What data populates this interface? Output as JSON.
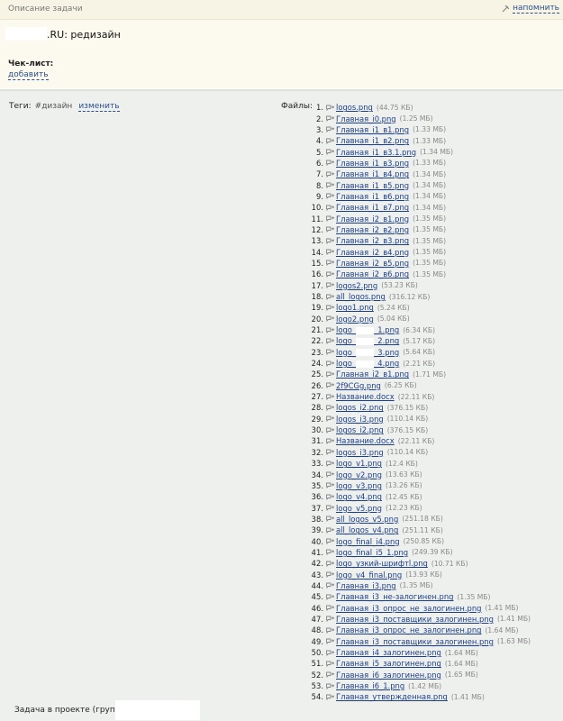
{
  "top_bar": {
    "title": "Описание задачи",
    "remind_label": "напомнить",
    "remind_icon": "pin-icon"
  },
  "header": {
    "project_suffix": ".RU:",
    "task_title": "редизайн"
  },
  "checklist": {
    "label": "Чек-лист:",
    "add_label": "добавить"
  },
  "tags": {
    "label": "Теги:",
    "items": [
      "#дизайн"
    ],
    "edit_label": "изменить"
  },
  "files_label": "Файлы:",
  "files": [
    {
      "n": "1.",
      "name": "logos.png",
      "size": "(44.75 КБ)"
    },
    {
      "n": "2.",
      "name": "Главная_i0.png",
      "size": "(1.25 МБ)"
    },
    {
      "n": "3.",
      "name": "Главная_i1_в1.png",
      "size": "(1.33 МБ)"
    },
    {
      "n": "4.",
      "name": "Главная_i1_в2.png",
      "size": "(1.33 МБ)"
    },
    {
      "n": "5.",
      "name": "Главная_i1_в3.1.png",
      "size": "(1.34 МБ)"
    },
    {
      "n": "6.",
      "name": "Главная_i1_в3.png",
      "size": "(1.33 МБ)"
    },
    {
      "n": "7.",
      "name": "Главная_i1_в4.png",
      "size": "(1.34 МБ)"
    },
    {
      "n": "8.",
      "name": "Главная_i1_в5.png",
      "size": "(1.34 МБ)"
    },
    {
      "n": "9.",
      "name": "Главная_i1_в6.png",
      "size": "(1.34 МБ)"
    },
    {
      "n": "10.",
      "name": "Главная_i1_в7.png",
      "size": "(1.34 МБ)"
    },
    {
      "n": "11.",
      "name": "Главная_i2_в1.png",
      "size": "(1.35 МБ)"
    },
    {
      "n": "12.",
      "name": "Главная_i2_в2.png",
      "size": "(1.35 МБ)"
    },
    {
      "n": "13.",
      "name": "Главная_i2_в3.png",
      "size": "(1.35 МБ)"
    },
    {
      "n": "14.",
      "name": "Главная_i2_в4.png",
      "size": "(1.35 МБ)"
    },
    {
      "n": "15.",
      "name": "Главная_i2_в5.png",
      "size": "(1.35 МБ)"
    },
    {
      "n": "16.",
      "name": "Главная_i2_в6.png",
      "size": "(1.35 МБ)"
    },
    {
      "n": "17.",
      "name": "logos2.png",
      "size": "(53.23 КБ)"
    },
    {
      "n": "18.",
      "name": "all_logos.png",
      "size": "(316.12 КБ)"
    },
    {
      "n": "19.",
      "name": "logo1.png",
      "size": "(5.24 КБ)"
    },
    {
      "n": "20.",
      "name": "logo2.png",
      "size": "(5.04 КБ)"
    },
    {
      "n": "21.",
      "name": "logo_",
      "name2": "_1.png",
      "size": "(6.34 КБ)"
    },
    {
      "n": "22.",
      "name": "logo_",
      "name2": "_2.png",
      "size": "(5.17 КБ)"
    },
    {
      "n": "23.",
      "name": "logo_",
      "name2": "_3.png",
      "size": "(5.64 КБ)"
    },
    {
      "n": "24.",
      "name": "logo_",
      "name2": "_4.png",
      "size": "(2.21 КБ)"
    },
    {
      "n": "25.",
      "name": "Главная_i2_в1.png",
      "size": "(1.71 МБ)"
    },
    {
      "n": "26.",
      "name": "2f9CGg.png",
      "size": "(6.25 КБ)"
    },
    {
      "n": "27.",
      "name": "Название.docx",
      "size": "(22.11 КБ)"
    },
    {
      "n": "28.",
      "name": "logos_i2.png",
      "size": "(376.15 КБ)"
    },
    {
      "n": "29.",
      "name": "logos_i3.png",
      "size": "(110.14 КБ)"
    },
    {
      "n": "30.",
      "name": "logos_i2.png",
      "size": "(376.15 КБ)"
    },
    {
      "n": "31.",
      "name": "Название.docx",
      "size": "(22.11 КБ)"
    },
    {
      "n": "32.",
      "name": "logos_i3.png",
      "size": "(110.14 КБ)"
    },
    {
      "n": "33.",
      "name": "logo_v1.png",
      "size": "(12.4 КБ)"
    },
    {
      "n": "34.",
      "name": "logo_v2.png",
      "size": "(13.63 КБ)"
    },
    {
      "n": "35.",
      "name": "logo_v3.png",
      "size": "(13.26 КБ)"
    },
    {
      "n": "36.",
      "name": "logo_v4.png",
      "size": "(12.45 КБ)"
    },
    {
      "n": "37.",
      "name": "logo_v5.png",
      "size": "(12.23 КБ)"
    },
    {
      "n": "38.",
      "name": "all_logos_v5.png",
      "size": "(251.18 КБ)"
    },
    {
      "n": "39.",
      "name": "all_logos_v4.png",
      "size": "(251.11 КБ)"
    },
    {
      "n": "40.",
      "name": "logo_final_i4.png",
      "size": "(250.85 КБ)"
    },
    {
      "n": "41.",
      "name": "logo_final_i5_1.png",
      "size": "(249.39 КБ)"
    },
    {
      "n": "42.",
      "name": "logo_узкий-шрифтl.png",
      "size": "(10.71 КБ)"
    },
    {
      "n": "43.",
      "name": "logo_v4_final.png",
      "size": "(13.93 КБ)"
    },
    {
      "n": "44.",
      "name": "Главная_i3.png",
      "size": "(1.35 МБ)"
    },
    {
      "n": "45.",
      "name": "Главная_i3_не-залогинен.png",
      "size": "(1.35 МБ)"
    },
    {
      "n": "46.",
      "name": "Главная_i3_опрос_не_залогинен.png",
      "size": "(1.41 МБ)"
    },
    {
      "n": "47.",
      "name": "Главная_i3_поставщики_залогинен.png",
      "size": "(1.41 МБ)"
    },
    {
      "n": "48.",
      "name": "Главная_i3_опрос_не_залогинен.png",
      "size": "(1.64 МБ)"
    },
    {
      "n": "49.",
      "name": "Главная_i3_поставщики_залогинен.png",
      "size": "(1.63 МБ)"
    },
    {
      "n": "50.",
      "name": "Главная_i4_залогинен.png",
      "size": "(1.64 МБ)"
    },
    {
      "n": "51.",
      "name": "Главная_i5_залогинен.png",
      "size": "(1.64 МБ)"
    },
    {
      "n": "52.",
      "name": "Главная_i6_залогинен.png",
      "size": "(1.65 МБ)"
    },
    {
      "n": "53.",
      "name": "Главная_i6_1.png",
      "size": "(1.42 МБ)"
    },
    {
      "n": "54.",
      "name": "Главная_утвержденная.png",
      "size": "(1.41 МБ)"
    }
  ],
  "file_icon": "comment-arrow-icon",
  "footer": {
    "project_label": "Задача в проекте (группе):"
  }
}
